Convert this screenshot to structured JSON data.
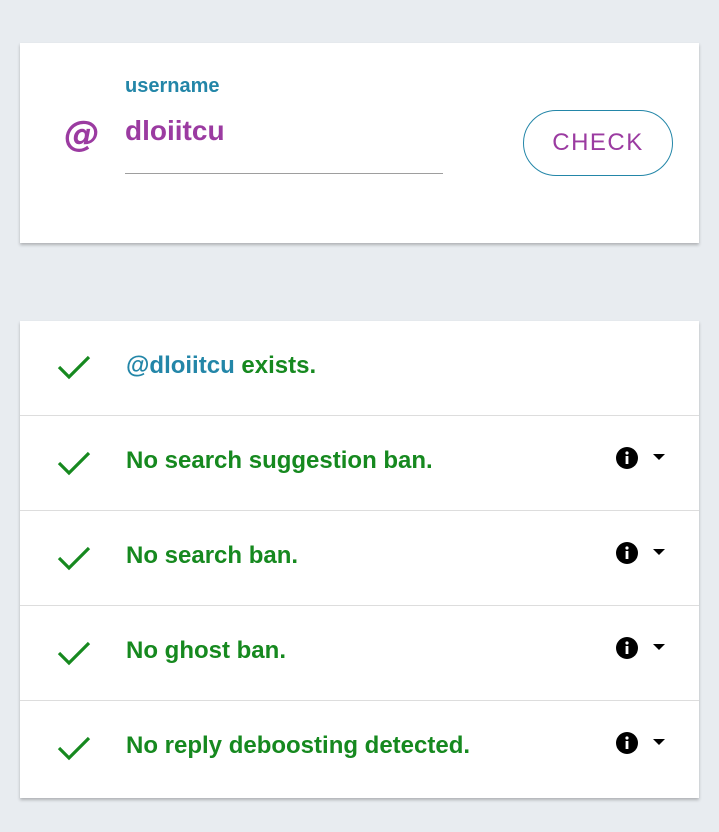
{
  "colors": {
    "accent_blue": "#2386a8",
    "accent_purple": "#9b3ba1",
    "success_green": "#16891f",
    "icon_black": "#000000"
  },
  "form": {
    "label": "username",
    "input_value": "dloiitcu",
    "at_symbol": "@",
    "check_button_label": "CHECK"
  },
  "results": {
    "exists": {
      "username": "@dloiitcu",
      "suffix": " exists.",
      "icon": "checkmark-icon"
    },
    "items": [
      {
        "label": "No search suggestion ban.",
        "icon": "checkmark-icon",
        "info_icon": "info-icon",
        "toggle_icon": "caret-down-icon"
      },
      {
        "label": "No search ban.",
        "icon": "checkmark-icon",
        "info_icon": "info-icon",
        "toggle_icon": "caret-down-icon"
      },
      {
        "label": "No ghost ban.",
        "icon": "checkmark-icon",
        "info_icon": "info-icon",
        "toggle_icon": "caret-down-icon"
      },
      {
        "label": "No reply deboosting detected.",
        "icon": "checkmark-icon",
        "info_icon": "info-icon",
        "toggle_icon": "caret-down-icon"
      }
    ]
  }
}
